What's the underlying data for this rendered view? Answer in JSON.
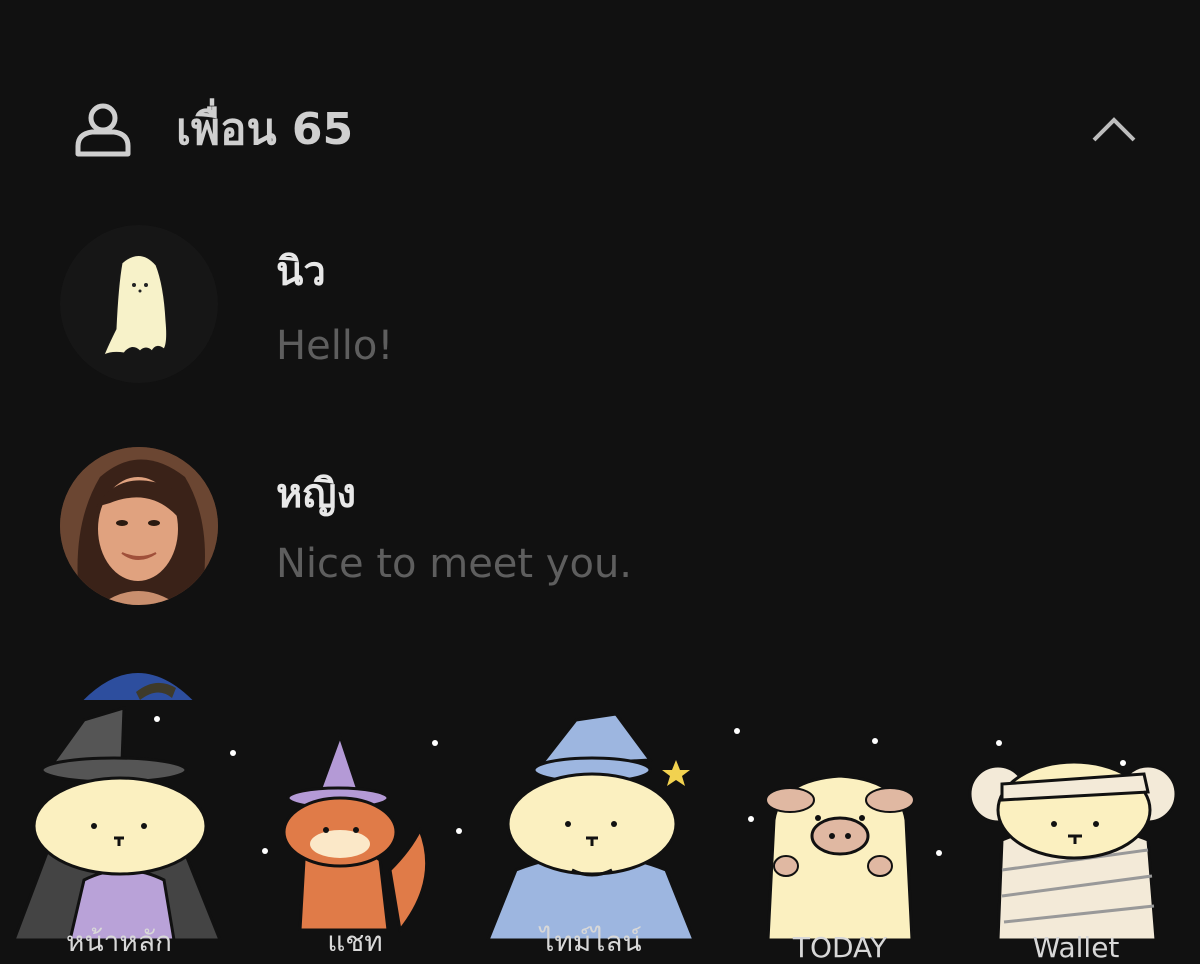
{
  "friends_section": {
    "title": "เพื่อน 65"
  },
  "friends": [
    {
      "name": "นิว",
      "status": "Hello!",
      "avatar": "ghost"
    },
    {
      "name": "หญิง",
      "status": "Nice to meet you."
    }
  ],
  "tabs": [
    {
      "label": "หน้าหลัก",
      "icon": "witch-dog-icon"
    },
    {
      "label": "แชท",
      "icon": "cat-witch-icon"
    },
    {
      "label": "ไทม์ไลน์",
      "icon": "wizard-dog-icon"
    },
    {
      "label": "TODAY",
      "icon": "ghost-pig-icon"
    },
    {
      "label": "Wallet",
      "icon": "mummy-dog-icon"
    }
  ],
  "colors": {
    "background": "#111111",
    "name": "#e8e8e8",
    "status": "#5e5e5e",
    "header": "#cfcfcf"
  }
}
